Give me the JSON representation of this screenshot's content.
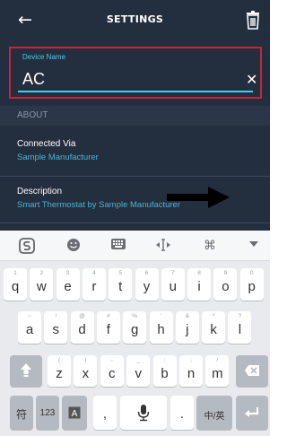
{
  "header": {
    "title": "SETTINGS",
    "back_icon": "arrow-left-icon",
    "delete_icon": "trash-icon"
  },
  "device_name": {
    "label": "Device Name",
    "value": "AC",
    "clear_icon": "close-icon"
  },
  "about": {
    "section_label": "ABOUT",
    "connected_via": {
      "title": "Connected Via",
      "value": "Sample Manufacturer"
    },
    "description": {
      "title": "Description",
      "value": "Smart Thermostat by Sample Manufacturer"
    }
  },
  "keyboard": {
    "toolbar": [
      "logo-s-icon",
      "emoji-icon",
      "keyboard-icon",
      "cursor-icon",
      "command-icon",
      "collapse-icon"
    ],
    "row1": [
      {
        "hint": "1",
        "key": "q"
      },
      {
        "hint": "2",
        "key": "w"
      },
      {
        "hint": "3",
        "key": "e"
      },
      {
        "hint": "4",
        "key": "r"
      },
      {
        "hint": "5",
        "key": "t"
      },
      {
        "hint": "6",
        "key": "y"
      },
      {
        "hint": "7",
        "key": "u"
      },
      {
        "hint": "8",
        "key": "i"
      },
      {
        "hint": "9",
        "key": "o"
      },
      {
        "hint": "0",
        "key": "p"
      }
    ],
    "row2": [
      {
        "hint": "~",
        "key": "a"
      },
      {
        "hint": "!",
        "key": "s"
      },
      {
        "hint": "@",
        "key": "d"
      },
      {
        "hint": "#",
        "key": "f"
      },
      {
        "hint": "%",
        "key": "g"
      },
      {
        "hint": "'",
        "key": "h"
      },
      {
        "hint": "&",
        "key": "j"
      },
      {
        "hint": "*",
        "key": "k"
      },
      {
        "hint": "?",
        "key": "l"
      }
    ],
    "row3": [
      {
        "hint": "(",
        "key": "z"
      },
      {
        "hint": ")",
        "key": "x"
      },
      {
        "hint": "-",
        "key": "c"
      },
      {
        "hint": "_",
        "key": "v"
      },
      {
        "hint": ":",
        "key": "b"
      },
      {
        "hint": ";",
        "key": "n"
      },
      {
        "hint": "/",
        "key": "m"
      }
    ],
    "row4": {
      "symbols": "符",
      "numbers": "123",
      "comma": ",",
      "period": ".",
      "lang": "中/英"
    }
  }
}
